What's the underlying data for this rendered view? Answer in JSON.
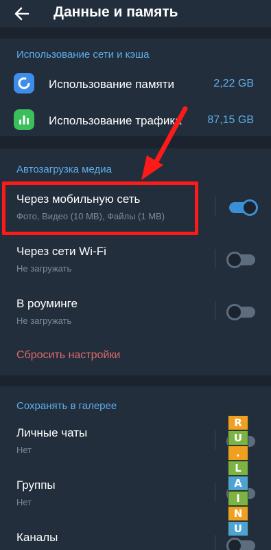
{
  "header": {
    "title": "Данные и память"
  },
  "usage": {
    "section_title": "Использование сети и кэша",
    "items": [
      {
        "label": "Использование памяти",
        "value": "2,22 GB",
        "icon": "storage-pie-icon",
        "color": "#3d8de9"
      },
      {
        "label": "Использование трафика",
        "value": "87,15 GB",
        "icon": "bar-chart-icon",
        "color": "#3bbf5c"
      }
    ]
  },
  "autodownload": {
    "section_title": "Автозагрузка медиа",
    "items": [
      {
        "label": "Через мобильную сеть",
        "sub": "Фото, Видео (10 MB), Файлы (1 MB)",
        "enabled": true
      },
      {
        "label": "Через сети Wi-Fi",
        "sub": "Не загружать",
        "enabled": false
      },
      {
        "label": "В роуминге",
        "sub": "Не загружать",
        "enabled": false
      }
    ],
    "reset_label": "Сбросить настройки"
  },
  "gallery": {
    "section_title": "Сохранять в галерее",
    "items": [
      {
        "label": "Личные чаты",
        "sub": "Нет",
        "enabled": false
      },
      {
        "label": "Группы",
        "sub": "Нет",
        "enabled": false
      },
      {
        "label": "Каналы",
        "sub": "",
        "enabled": false
      }
    ]
  },
  "watermark": {
    "letters": [
      "R",
      "U",
      ".",
      "L",
      "A",
      "I",
      "N",
      "U"
    ],
    "colors": [
      "#f0a020",
      "#7cb342",
      "#f0a020",
      "#7cb342",
      "#4fa3d1",
      "#7cb342",
      "#f0a020",
      "#4fa3d1"
    ]
  },
  "colors": {
    "accent": "#5faeea",
    "danger": "#e06a6a",
    "annotation": "#ff1a1a"
  }
}
